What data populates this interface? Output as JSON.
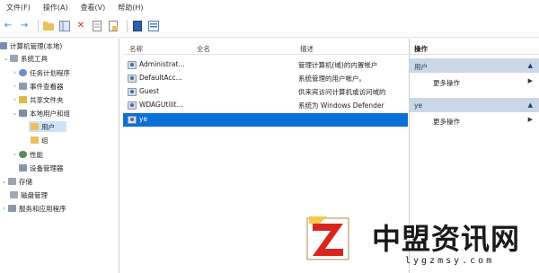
{
  "menu": [
    "文件(F)",
    "操作(A)",
    "查看(V)",
    "帮助(H)"
  ],
  "toolbar": {
    "icons": [
      "back-arrow-icon",
      "forward-arrow-icon",
      "up-folder-icon",
      "show-tree-icon",
      "delete-icon",
      "properties-icon",
      "export-icon",
      "help-icon",
      "view-icon"
    ]
  },
  "tree": {
    "items": [
      {
        "label": "计算机管理(本地)"
      },
      {
        "label": "系统工具"
      },
      {
        "label": "任务计划程序"
      },
      {
        "label": "事件查看器"
      },
      {
        "label": "共享文件夹"
      },
      {
        "label": "本地用户和组"
      },
      {
        "label": "用户"
      },
      {
        "label": "组"
      },
      {
        "label": "性能"
      },
      {
        "label": "设备管理器"
      },
      {
        "label": "存储"
      },
      {
        "label": "磁盘管理"
      },
      {
        "label": "服务和应用程序"
      }
    ]
  },
  "list": {
    "columns": [
      "名称",
      "全名",
      "描述"
    ],
    "rows": [
      {
        "name": "Administrat...",
        "fullname": "",
        "desc": "管理计算机(域)的内置帐户"
      },
      {
        "name": "DefaultAcc...",
        "fullname": "",
        "desc": "系统管理的用户帐户。"
      },
      {
        "name": "Guest",
        "fullname": "",
        "desc": "供来宾访问计算机或访问域的"
      },
      {
        "name": "WDAGUtilit...",
        "fullname": "",
        "desc": "系统为 Windows Defender"
      },
      {
        "name": "ye",
        "fullname": "",
        "desc": ""
      }
    ]
  },
  "actions": {
    "title": "操作",
    "sections": [
      {
        "header": "用户",
        "item": "更多操作"
      },
      {
        "header": "ye",
        "item": "更多操作"
      }
    ]
  },
  "watermark": {
    "text": "中盟资讯网",
    "domain": "lygzmsy.com"
  },
  "colors": {
    "selection": "#0a6fd6",
    "tree_selection": "#cce4f7",
    "action_header": "#cbd7e6",
    "logo_red": "#d9261c"
  }
}
